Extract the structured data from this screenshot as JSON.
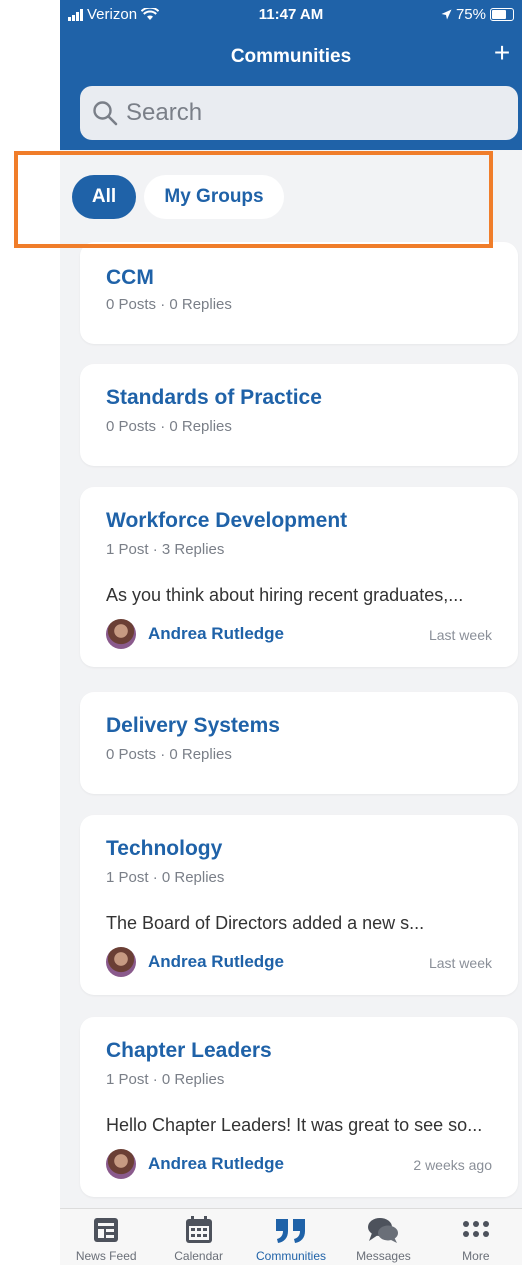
{
  "status_bar": {
    "carrier": "Verizon",
    "time": "11:47 AM",
    "battery": "75%"
  },
  "header": {
    "title": "Communities",
    "add_label": "+"
  },
  "search": {
    "placeholder": "Search"
  },
  "filters": {
    "all_label": "All",
    "my_groups_label": "My Groups",
    "selected": "All"
  },
  "communities": [
    {
      "title": "CCM",
      "meta": "0 Posts · 0 Replies"
    },
    {
      "title": "Standards of Practice",
      "meta": "0 Posts · 0 Replies"
    },
    {
      "title": "Workforce Development",
      "meta": "1 Post · 3 Replies",
      "snippet": "As you think about hiring recent graduates,...",
      "author": "Andrea Rutledge",
      "time": "Last week"
    },
    {
      "title": "Delivery Systems",
      "meta": "0 Posts · 0 Replies"
    },
    {
      "title": "Technology",
      "meta": "1 Post · 0 Replies",
      "snippet": "The Board of Directors added a new s...",
      "author": "Andrea Rutledge",
      "time": "Last week"
    },
    {
      "title": "Chapter Leaders",
      "meta": "1 Post · 0 Replies",
      "snippet": "Hello Chapter Leaders! It was great to see so...",
      "author": "Andrea Rutledge",
      "time": "2 weeks ago"
    }
  ],
  "tabbar": [
    {
      "label": "News Feed",
      "icon": "news-feed-icon"
    },
    {
      "label": "Calendar",
      "icon": "calendar-icon"
    },
    {
      "label": "Communities",
      "icon": "quote-icon",
      "active": true
    },
    {
      "label": "Messages",
      "icon": "chat-bubbles-icon"
    },
    {
      "label": "More",
      "icon": "more-dots-icon"
    }
  ],
  "colors": {
    "brand": "#1f62a8",
    "highlight": "#f07d2a",
    "background": "#f2f3f5"
  }
}
